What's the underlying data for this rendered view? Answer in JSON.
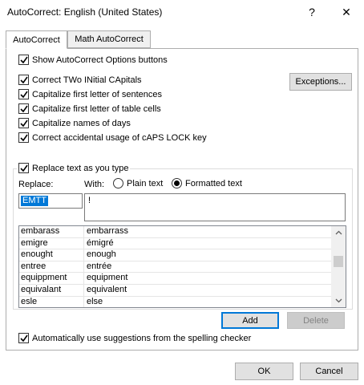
{
  "window": {
    "title": "AutoCorrect: English (United States)",
    "help_glyph": "?",
    "close_glyph": "✕"
  },
  "tabs": [
    {
      "label": "AutoCorrect",
      "active": true
    },
    {
      "label": "Math AutoCorrect",
      "active": false
    }
  ],
  "options": {
    "show_buttons": {
      "label": "Show AutoCorrect Options buttons",
      "checked": true
    },
    "two_initial_caps": {
      "label": "Correct TWo INitial CApitals",
      "checked": true
    },
    "cap_sentences": {
      "label": "Capitalize first letter of sentences",
      "checked": true
    },
    "cap_table_cells": {
      "label": "Capitalize first letter of table cells",
      "checked": true
    },
    "cap_days": {
      "label": "Capitalize names of days",
      "checked": true
    },
    "caps_lock": {
      "label": "Correct accidental usage of cAPS LOCK key",
      "checked": true
    }
  },
  "exceptions_button": "Exceptions...",
  "replace_group": {
    "enable_label": "Replace text as you type",
    "enabled": true,
    "replace_label": "Replace:",
    "with_label": "With:",
    "plain_text_label": "Plain text",
    "formatted_text_label": "Formatted text",
    "selected_format": "formatted",
    "replace_value": "EMTT",
    "with_value": "!"
  },
  "entries": [
    {
      "replace": "embarass",
      "with": "embarrass"
    },
    {
      "replace": "emigre",
      "with": "émigré"
    },
    {
      "replace": "enought",
      "with": "enough"
    },
    {
      "replace": "entree",
      "with": "entrée"
    },
    {
      "replace": "equippment",
      "with": "equipment"
    },
    {
      "replace": "equivalant",
      "with": "equivalent"
    },
    {
      "replace": "esle",
      "with": "else"
    }
  ],
  "list_buttons": {
    "add": "Add",
    "delete": "Delete"
  },
  "spelling_suggestions": {
    "label": "Automatically use suggestions from the spelling checker",
    "checked": true
  },
  "dialog_buttons": {
    "ok": "OK",
    "cancel": "Cancel"
  },
  "colors": {
    "accent": "#0078d7",
    "button_face": "#e1e1e1",
    "border": "#adadad"
  }
}
